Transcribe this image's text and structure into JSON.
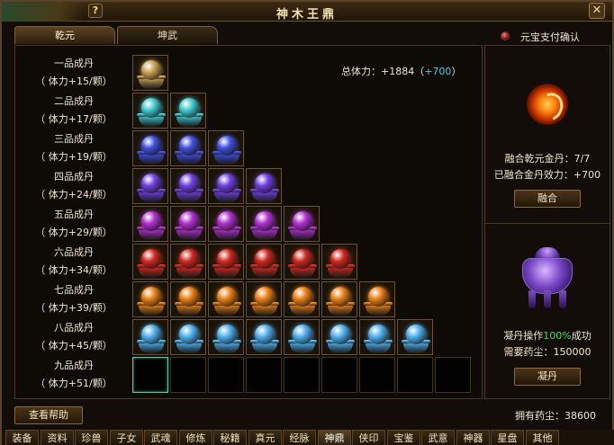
{
  "window": {
    "title": "神木王鼎"
  },
  "tabs": [
    {
      "label": "乾元"
    },
    {
      "label": "坤武"
    }
  ],
  "payment": {
    "label": "元宝支付确认"
  },
  "stamina": {
    "prefix": "总体力：+1884（",
    "bonus": "+700",
    "suffix": "）"
  },
  "grades": [
    {
      "name": "一品成丹",
      "bonus": "（ 体力+15/颗）",
      "count": 1,
      "filled": 1,
      "pill_color": "#c8a050"
    },
    {
      "name": "二品成丹",
      "bonus": "（ 体力+17/颗）",
      "count": 2,
      "filled": 2,
      "pill_color": "#40c8d0"
    },
    {
      "name": "三品成丹",
      "bonus": "（ 体力+19/颗）",
      "count": 3,
      "filled": 3,
      "pill_color": "#4050e0"
    },
    {
      "name": "四品成丹",
      "bonus": "（ 体力+24/颗）",
      "count": 4,
      "filled": 4,
      "pill_color": "#7040e0"
    },
    {
      "name": "五品成丹",
      "bonus": "（ 体力+29/颗）",
      "count": 5,
      "filled": 5,
      "pill_color": "#b030d0"
    },
    {
      "name": "六品成丹",
      "bonus": "（ 体力+34/颗）",
      "count": 6,
      "filled": 6,
      "pill_color": "#d02820"
    },
    {
      "name": "七品成丹",
      "bonus": "（ 体力+39/颗）",
      "count": 7,
      "filled": 7,
      "pill_color": "#e88018"
    },
    {
      "name": "八品成丹",
      "bonus": "（ 体力+45/颗）",
      "count": 8,
      "filled": 8,
      "pill_color": "#50b0f0"
    },
    {
      "name": "九品成丹",
      "bonus": "（ 体力+51/颗）",
      "count": 9,
      "filled": 0,
      "pill_color": "#202020"
    }
  ],
  "fusion": {
    "progress_label": "融合乾元金丹：7/7",
    "effect_label": "已融合金丹效力：+700",
    "button": "融合"
  },
  "condense": {
    "op_prefix": "凝丹操作",
    "op_rate": "100%",
    "op_suffix": "成功",
    "cost_label": "需要药尘：150000",
    "button": "凝丹"
  },
  "help_button": "查看帮助",
  "owned_dust": "拥有药尘：38600",
  "bottom_tabs": [
    "装备",
    "资料",
    "珍兽",
    "子女",
    "武魂",
    "修炼",
    "秘籍",
    "真元",
    "经脉",
    "神鼎",
    "侠印",
    "宝鉴",
    "武意",
    "神器",
    "星盘",
    "其他"
  ],
  "bottom_tabs_active": "神鼎",
  "colors": {
    "accent_bonus": "#48d0e8",
    "success_green": "#3ee050",
    "frame_gold": "#8a6a3a"
  }
}
